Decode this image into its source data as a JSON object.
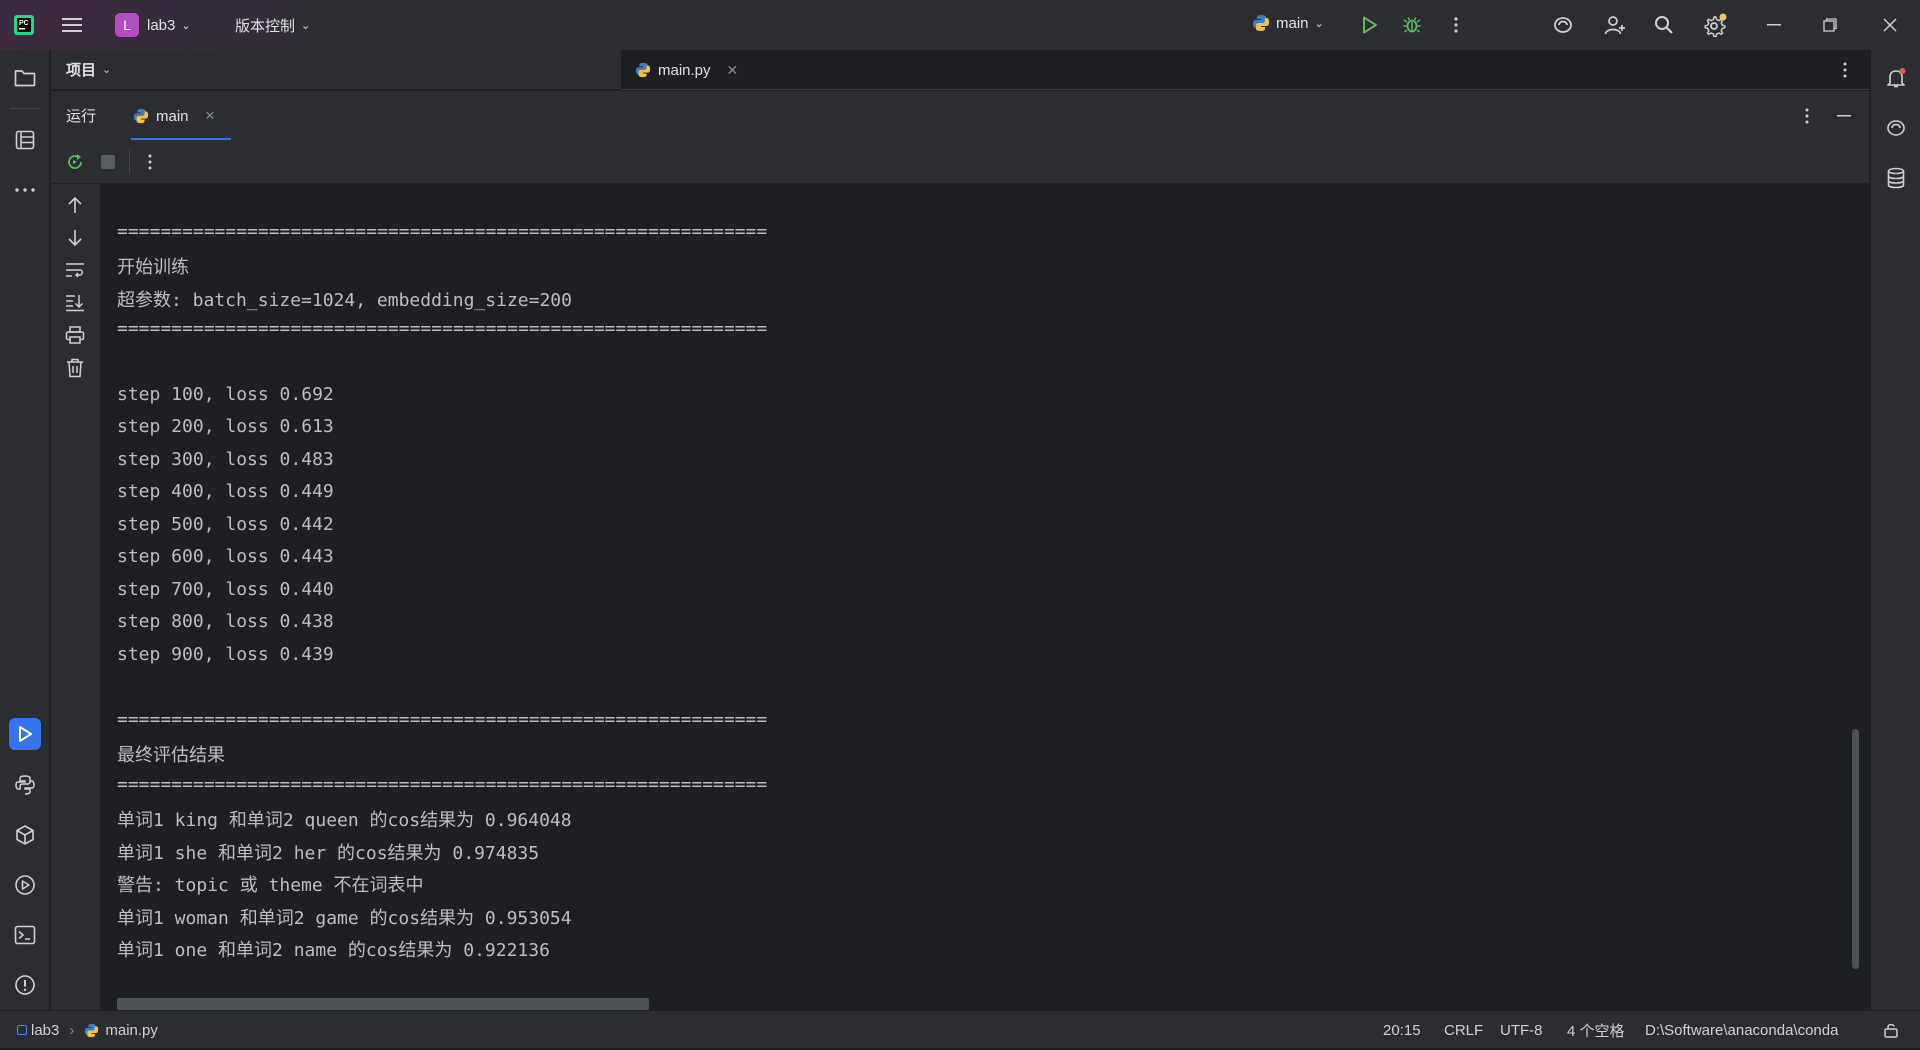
{
  "titlebar": {
    "project_initial": "L",
    "project_name": "lab3",
    "vcs_label": "版本控制",
    "run_config": "main"
  },
  "project_panel": {
    "title": "项目"
  },
  "editor_tabs": [
    {
      "label": "main.py"
    }
  ],
  "run_panel": {
    "title": "运行",
    "tab_label": "main"
  },
  "console_lines": [
    "============================================================",
    "开始训练",
    "超参数: batch_size=1024, embedding_size=200",
    "============================================================",
    "",
    "step 100, loss 0.692",
    "step 200, loss 0.613",
    "step 300, loss 0.483",
    "step 400, loss 0.449",
    "step 500, loss 0.442",
    "step 600, loss 0.443",
    "step 700, loss 0.440",
    "step 800, loss 0.438",
    "step 900, loss 0.439",
    "",
    "============================================================",
    "最终评估结果",
    "============================================================",
    "单词1 king 和单词2 queen 的cos结果为 0.964048",
    "单词1 she 和单词2 her 的cos结果为 0.974835",
    "警告: topic 或 theme 不在词表中",
    "单词1 woman 和单词2 game 的cos结果为 0.953054",
    "单词1 one 和单词2 name 的cos结果为 0.922136"
  ],
  "statusbar": {
    "breadcrumb_project": "lab3",
    "breadcrumb_file": "main.py",
    "position": "20:15",
    "line_ending": "CRLF",
    "encoding": "UTF-8",
    "indent": "4 个空格",
    "interpreter": "D:\\Software\\anaconda\\conda"
  },
  "colors": {
    "accent": "#3574f0",
    "run_green": "#5fb865",
    "project_badge": "#b44cc2"
  }
}
